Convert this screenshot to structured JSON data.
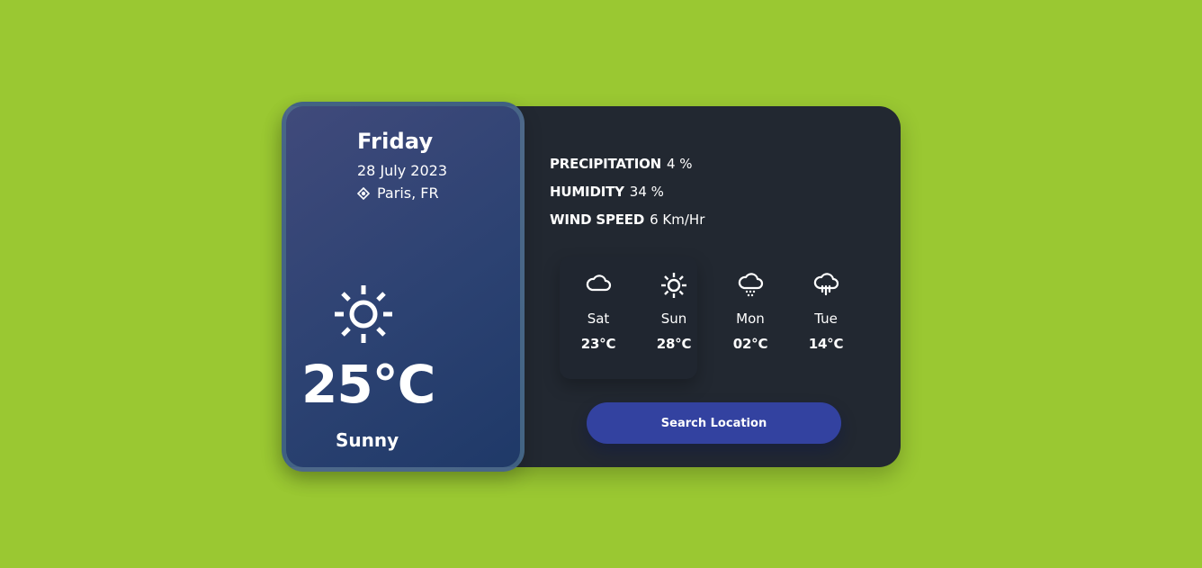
{
  "theme": {
    "page_background": "#9ac832",
    "card_background": "#222831",
    "panel_gradient_start": "#404a7b",
    "panel_gradient_end": "#1f3968",
    "accent_button": "#3342a0",
    "text": "#ffffff"
  },
  "current": {
    "day": "Friday",
    "date": "28 July 2023",
    "location": "Paris, FR",
    "location_icon": "location-icon",
    "weather_icon": "sun-icon",
    "temperature": "25°C",
    "condition": "Sunny"
  },
  "stats": [
    {
      "label": "PRECIPITATION",
      "value": "4 %"
    },
    {
      "label": "HUMIDITY",
      "value": "34 %"
    },
    {
      "label": "WIND SPEED",
      "value": "6 Km/Hr"
    }
  ],
  "forecast": [
    {
      "day": "Sat",
      "temp": "23°C",
      "icon": "cloud-icon",
      "active": true
    },
    {
      "day": "Sun",
      "temp": "28°C",
      "icon": "sun-icon",
      "active": true
    },
    {
      "day": "Mon",
      "temp": "02°C",
      "icon": "snow-cloud-icon",
      "active": false
    },
    {
      "day": "Tue",
      "temp": "14°C",
      "icon": "rain-cloud-icon",
      "active": false
    }
  ],
  "search_button_label": "Search Location"
}
